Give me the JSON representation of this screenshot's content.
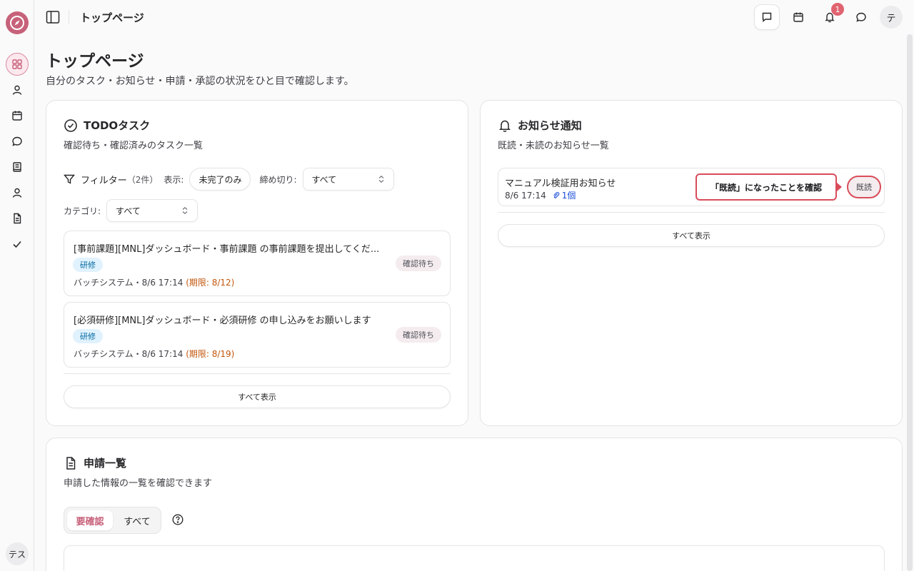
{
  "header": {
    "title": "トップページ",
    "notification_count": "1",
    "avatar_initial": "テ"
  },
  "sidebar": {
    "user_initials": "テス"
  },
  "page": {
    "title": "トップページ",
    "subtitle": "自分のタスク・お知らせ・申請・承認の状況をひと目で確認します。"
  },
  "todo": {
    "title": "TODOタスク",
    "description": "確認待ち・確認済みのタスク一覧",
    "filter_label": "フィルター",
    "filter_count": "（2件）",
    "display_label": "表示:",
    "display_value": "未完了のみ",
    "deadline_label": "締め切り:",
    "deadline_value": "すべて",
    "category_label": "カテゴリ:",
    "category_value": "すべて",
    "tasks": [
      {
        "title": "[事前課題][MNL]ダッシュボード・事前課題 の事前課題を提出してくだ...",
        "tag": "研修",
        "status": "確認待ち",
        "meta": "バッチシステム・8/6 17:14",
        "deadline": "(期限: 8/12)"
      },
      {
        "title": "[必須研修][MNL]ダッシュボード・必須研修 の申し込みをお願いします",
        "tag": "研修",
        "status": "確認待ち",
        "meta": "バッチシステム・8/6 17:14",
        "deadline": "(期限: 8/19)"
      }
    ],
    "show_all": "すべて表示"
  },
  "notices": {
    "title": "お知らせ通知",
    "description": "既読・未読のお知らせ一覧",
    "items": [
      {
        "title": "マニュアル検証用お知らせ",
        "time": "8/6 17:14",
        "attachments": "1個",
        "read_label": "既読"
      }
    ],
    "callout": "「既読」になったことを確認",
    "show_all": "すべて表示"
  },
  "applications": {
    "title": "申請一覧",
    "description": "申請した情報の一覧を確認できます",
    "tabs": [
      {
        "label": "要確認",
        "active": true
      },
      {
        "label": "すべて",
        "active": false
      }
    ]
  },
  "colors": {
    "accent": "#c7617a",
    "danger": "#d94c5a",
    "tag_bg": "#e0f2fe",
    "deadline": "#c2570c"
  }
}
